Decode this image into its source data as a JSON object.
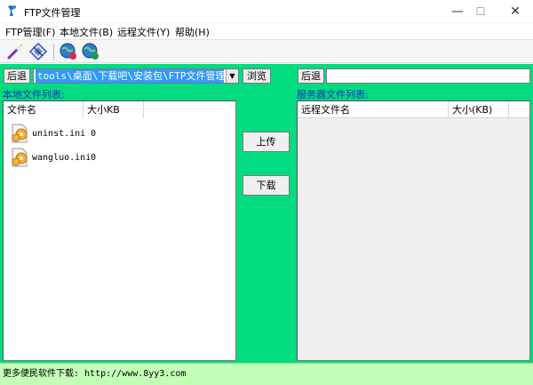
{
  "window": {
    "title": "FTP文件管理",
    "minimize_glyph": "—",
    "maximize_glyph": "☐",
    "close_glyph": "✕"
  },
  "menu": [
    {
      "label": "FTP管理(F)"
    },
    {
      "label": "本地文件(B)"
    },
    {
      "label": "远程文件(Y)"
    },
    {
      "label": "帮助(H)"
    }
  ],
  "toolbar": {
    "icons": [
      "connect-wand-icon",
      "disconnect-diamond-icon",
      "search-globe-icon",
      "refresh-globe-icon"
    ]
  },
  "local": {
    "back_label": "后退",
    "path_value": "tools\\桌面\\下载吧\\安装包\\FTP文件管理",
    "browse_label": "浏览",
    "section_label": "本地文件列表:",
    "columns": [
      "文件名",
      "大小KB"
    ],
    "files": [
      {
        "name": "uninst.ini",
        "size": "0"
      },
      {
        "name": "wangluo.ini",
        "size": "0"
      }
    ]
  },
  "transfer": {
    "upload_label": "上传",
    "download_label": "下载"
  },
  "remote": {
    "back_label": "后退",
    "path_value": "",
    "section_label": "服务器文件列表:",
    "columns": [
      "远程文件名",
      "大小(KB)"
    ]
  },
  "status": {
    "text": "更多便民软件下载: http://www.8yy3.com"
  },
  "colors": {
    "main_background": "#00dc7f",
    "status_background": "#c3ffb6",
    "section_label": "#1f2ecc",
    "selection": "#3399ff"
  }
}
